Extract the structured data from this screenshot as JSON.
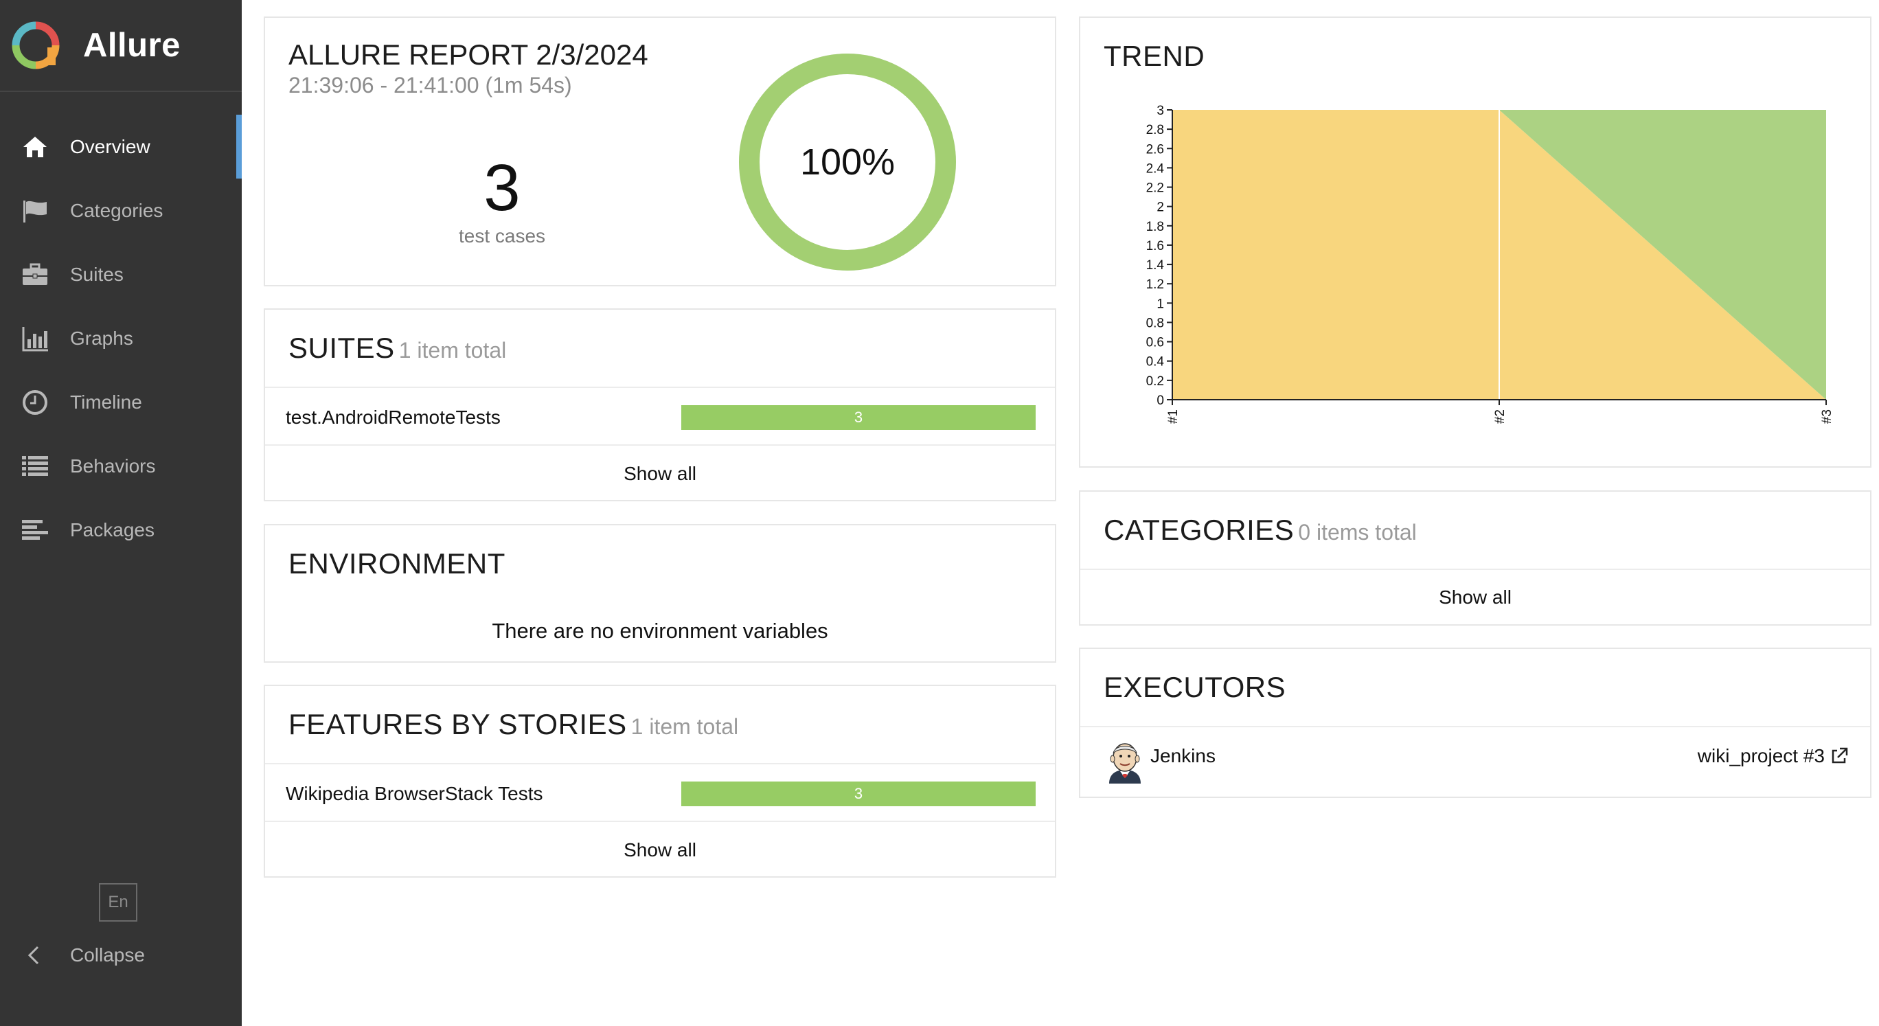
{
  "app": {
    "name": "Allure"
  },
  "sidebar": {
    "items": [
      {
        "label": "Overview",
        "icon": "home-icon",
        "active": true
      },
      {
        "label": "Categories",
        "icon": "flag-icon"
      },
      {
        "label": "Suites",
        "icon": "briefcase-icon"
      },
      {
        "label": "Graphs",
        "icon": "bar-chart-icon"
      },
      {
        "label": "Timeline",
        "icon": "clock-icon"
      },
      {
        "label": "Behaviors",
        "icon": "list-icon"
      },
      {
        "label": "Packages",
        "icon": "align-left-icon"
      }
    ],
    "language": "En",
    "collapse_label": "Collapse"
  },
  "summary": {
    "title": "ALLURE REPORT 2/3/2024",
    "time": "21:39:06 - 21:41:00 (1m 54s)",
    "count": "3",
    "count_label": "test cases",
    "percent_label": "100%",
    "passed_fraction": 1.0
  },
  "suites": {
    "title": "SUITES",
    "subtitle": "1 item total",
    "rows": [
      {
        "name": "test.AndroidRemoteTests",
        "count": "3"
      }
    ],
    "show_all": "Show all"
  },
  "environment": {
    "title": "ENVIRONMENT",
    "empty_text": "There are no environment variables"
  },
  "features": {
    "title": "FEATURES BY STORIES",
    "subtitle": "1 item total",
    "rows": [
      {
        "name": "Wikipedia BrowserStack Tests",
        "count": "3"
      }
    ],
    "show_all": "Show all"
  },
  "trend": {
    "title": "TREND"
  },
  "categories": {
    "title": "CATEGORIES",
    "subtitle": "0 items total",
    "show_all": "Show all"
  },
  "executors": {
    "title": "EXECUTORS",
    "name": "Jenkins",
    "build": "wiki_project #3"
  },
  "colors": {
    "passed": "#97cc64",
    "broken": "#ffd050",
    "accent": "#5a9dd8",
    "sidebar": "#343434"
  },
  "chart_data": {
    "type": "area",
    "title": "TREND",
    "x": [
      "#1",
      "#2",
      "#3"
    ],
    "ylim": [
      0,
      3
    ],
    "yticks": [
      "0",
      "0.2",
      "0.4",
      "0.6",
      "0.8",
      "1",
      "1.2",
      "1.4",
      "1.6",
      "1.8",
      "2",
      "2.2",
      "2.4",
      "2.6",
      "2.8",
      "3"
    ],
    "stacked": true,
    "series": [
      {
        "values": [
          3,
          3,
          0
        ],
        "color": "#f8d67e"
      },
      {
        "values": [
          0,
          0,
          3
        ],
        "color": "#acd283"
      }
    ]
  }
}
